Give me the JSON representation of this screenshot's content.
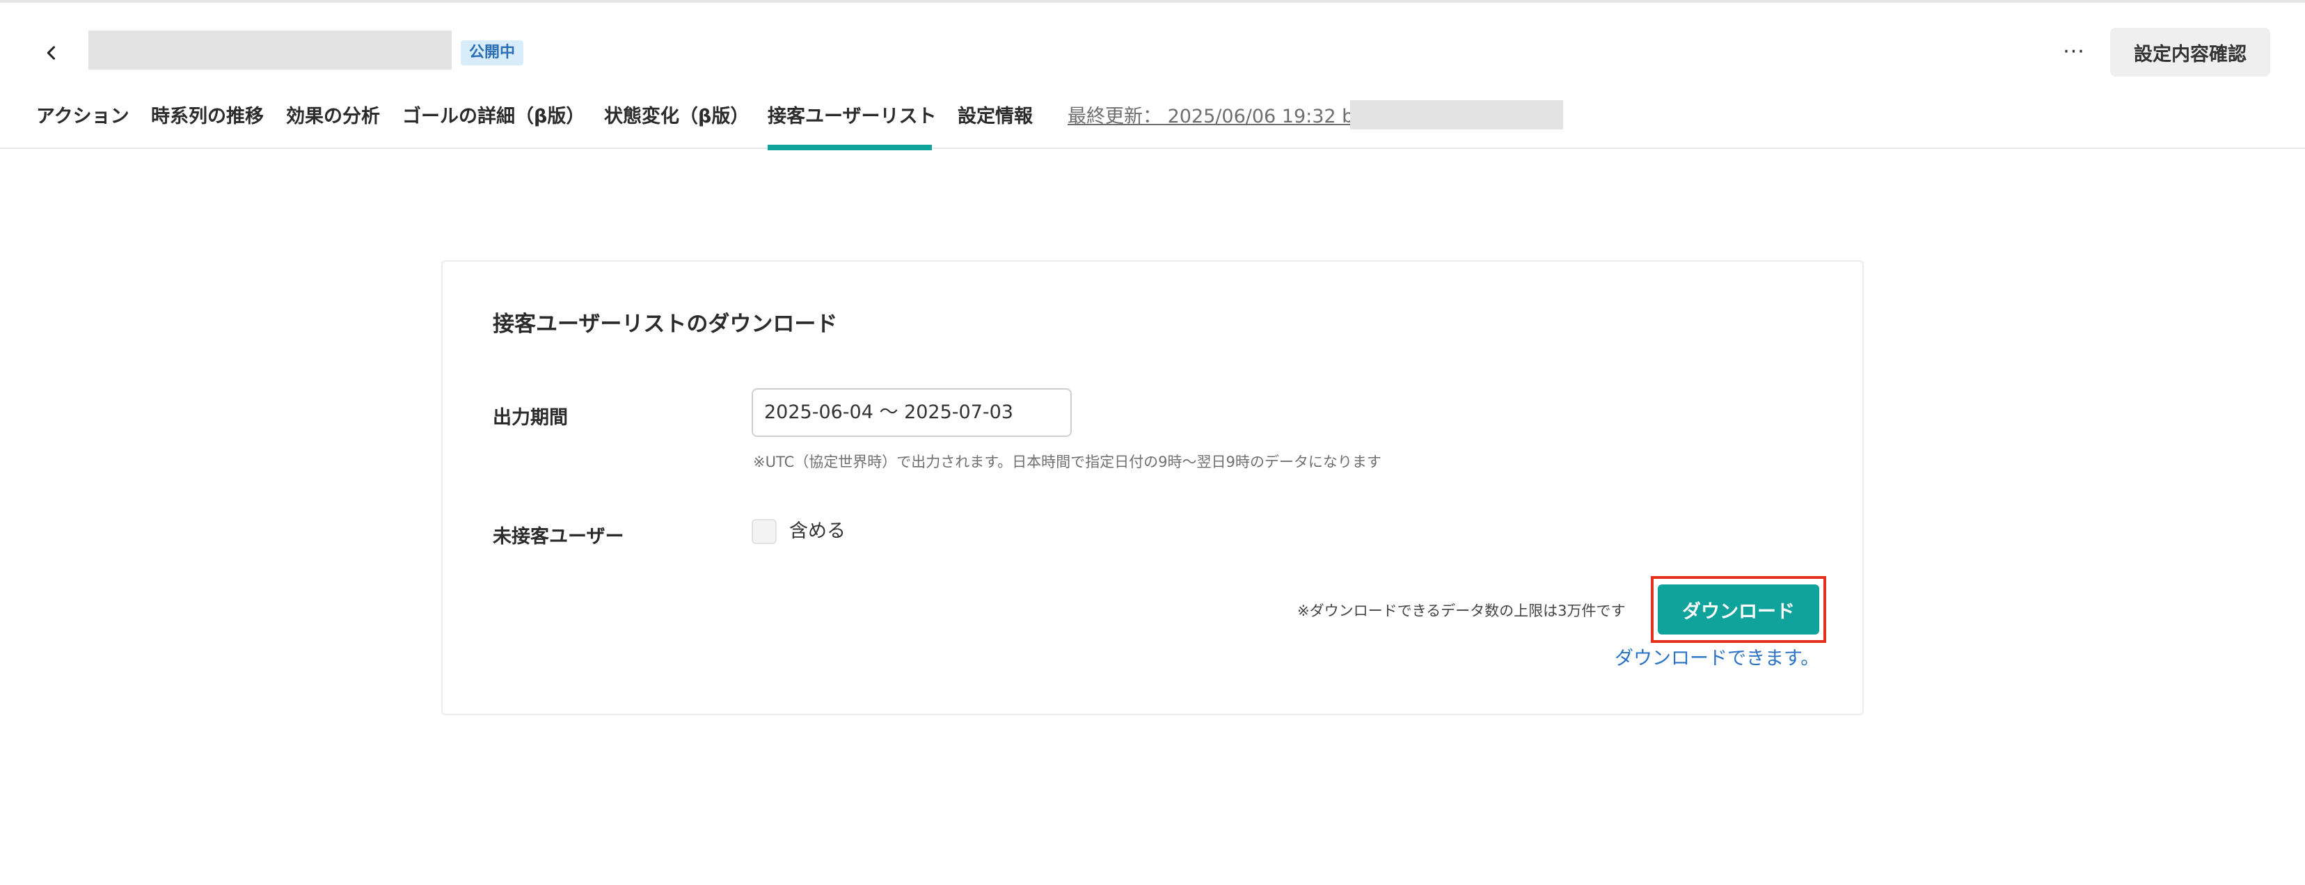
{
  "header": {
    "status_badge": "公開中",
    "more_label": "···",
    "confirm_button": "設定内容確認"
  },
  "tabs": [
    {
      "label": "アクション"
    },
    {
      "label": "時系列の推移"
    },
    {
      "label": "効果の分析"
    },
    {
      "label": "ゴールの詳細（β版）"
    },
    {
      "label": "状態変化（β版）"
    },
    {
      "label": "接客ユーザーリスト",
      "active": true
    },
    {
      "label": "設定情報"
    }
  ],
  "last_updated": "最終更新： 2025/06/06 19:32 by",
  "card": {
    "title": "接客ユーザーリストのダウンロード",
    "period_label": "出力期間",
    "period_value": "2025-06-04  〜  2025-07-03",
    "utc_note": "※UTC（協定世界時）で出力されます。日本時間で指定日付の9時〜翌日9時のデータになります",
    "unserved_label": "未接客ユーザー",
    "include_label": "含める",
    "include_checked": false,
    "limit_note": "※ダウンロードできるデータ数の上限は3万件です",
    "download_button": "ダウンロード",
    "download_status": "ダウンロードできます。"
  },
  "colors": {
    "accent": "#0fa39b",
    "highlight": "#e3301c",
    "link": "#2a73c4",
    "badge_bg": "#d8ecfa",
    "badge_text": "#2a6fb5"
  }
}
